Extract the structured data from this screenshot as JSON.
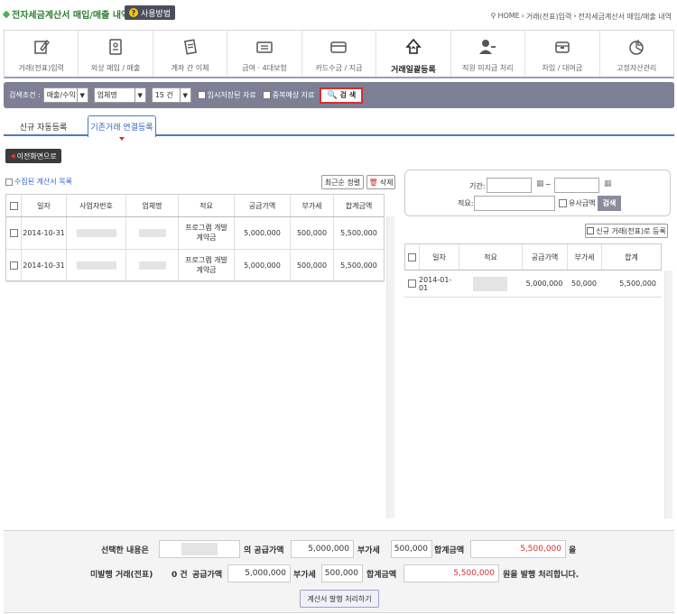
{
  "header": {
    "title": "전자세금계산서 매입/매출 내역",
    "help_label": "사용방법",
    "breadcrumb": [
      "HOME",
      "거래(전표)입력",
      "전자세금계산서 매입/매출 내역"
    ]
  },
  "menu": [
    {
      "label": "거래(전표)입력",
      "icon": "edit-icon"
    },
    {
      "label": "외상 매입 / 매출",
      "icon": "ledger-icon"
    },
    {
      "label": "계좌 간 이체",
      "icon": "transfer-doc-icon"
    },
    {
      "label": "급여 · 4대보험",
      "icon": "id-card-icon"
    },
    {
      "label": "카드수금 / 지급",
      "icon": "card-icon"
    },
    {
      "label": "거래일괄등록",
      "icon": "bulk-upload-icon",
      "active": true
    },
    {
      "label": "직원 미지급 처리",
      "icon": "person-icon"
    },
    {
      "label": "차입 / 대여금",
      "icon": "wallet-icon"
    },
    {
      "label": "고정자산관리",
      "icon": "pie-icon"
    }
  ],
  "search": {
    "label": "검색조건 :",
    "type_value": "매출/수익",
    "field_value": "업체명",
    "count_value": "15 건",
    "temp_saved_label": "임시저장된 자료",
    "dup_label": "중복예상 자료",
    "search_button": "검 색"
  },
  "tabs": {
    "new": "신규 자동등록",
    "existing": "기존거래 연결등록"
  },
  "back_button": "이전화면으로",
  "left": {
    "list_title": "수집된 계산서 목록",
    "sort_button": "최근순 정렬",
    "delete_button": "삭제",
    "columns": [
      "일자",
      "사업자번호",
      "업체명",
      "적요",
      "공급가액",
      "부가세",
      "합계금액"
    ],
    "rows": [
      {
        "date": "2014-10-31",
        "memo": "프로그램 개발 계약금",
        "supply": "5,000,000",
        "vat": "500,000",
        "total": "5,500,000"
      },
      {
        "date": "2014-10-31",
        "memo": "프로그램 개발 계약금",
        "supply": "5,000,000",
        "vat": "500,000",
        "total": "5,500,000"
      }
    ]
  },
  "right": {
    "period_label": "기간:",
    "period_sep": "~",
    "memo_label": "적요:",
    "similar_label": "유사금액",
    "search_button": "검색",
    "new_register_button": "신규 거래(전표)로 등록",
    "columns": [
      "일자",
      "적요",
      "공급가액",
      "부가세",
      "합계"
    ],
    "rows": [
      {
        "date": "2014-01-01",
        "supply": "5,000,000",
        "vat": "50,000",
        "total": "5,500,000"
      }
    ]
  },
  "bottom": {
    "selected_prefix": "선택한 내용은",
    "supply_suffix": "의 공급가액",
    "supply": "5,000,000",
    "vat_label": "부가세",
    "vat": "500,000",
    "total_label": "합계금액",
    "total": "5,500,000",
    "total_suffix": "을",
    "unissued_label": "미발행 거래(전표)",
    "unissued_count": "0 건",
    "supply_label": "공급가액",
    "supply2": "5,000,000",
    "vat_label2": "부가세",
    "vat2": "500,000",
    "total_label2": "합계금액",
    "total2": "5,500,000",
    "final_suffix": "원을 발행 처리합니다.",
    "issue_button": "계산서 발행 처리하기"
  },
  "colors": {
    "accent": "#4a7bc0",
    "search_bar": "#7d8095",
    "alert": "#d32f2f",
    "title": "#2e7d32"
  }
}
